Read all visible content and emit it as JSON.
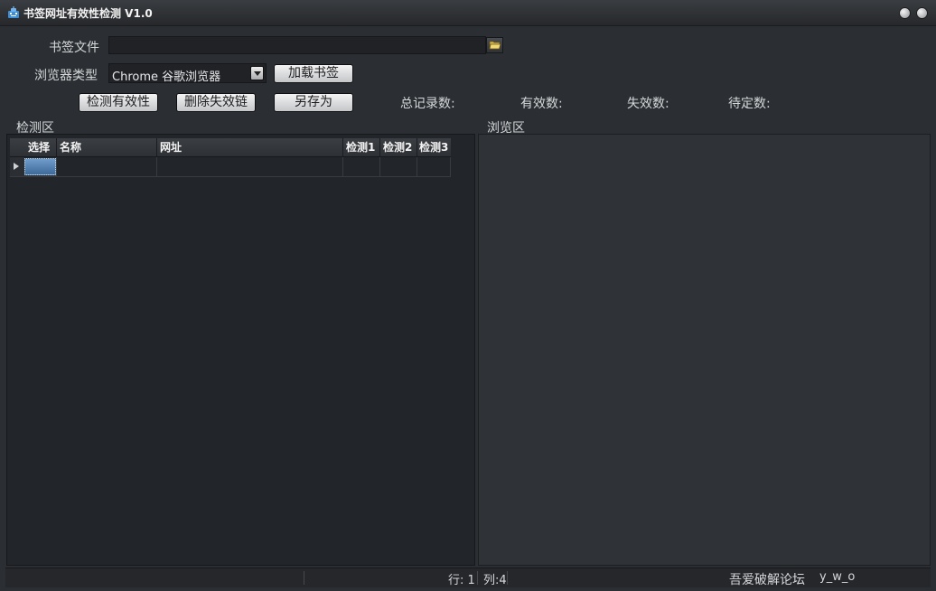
{
  "window": {
    "title": "书签网址有效性检测 V1.0"
  },
  "form": {
    "bookmark_file_label": "书签文件",
    "bookmark_file_value": "",
    "browser_type_label": "浏览器类型",
    "browser_selected": "Chrome 谷歌浏览器",
    "load_button": "加载书签",
    "check_button": "检测有效性",
    "delete_button": "删除失效链",
    "save_as_button": "另存为"
  },
  "stats": {
    "total_label": "总记录数:",
    "valid_label": "有效数:",
    "invalid_label": "失效数:",
    "pending_label": "待定数:"
  },
  "panels": {
    "check_area_label": "检测区",
    "browse_area_label": "浏览区"
  },
  "grid": {
    "columns": [
      "选择",
      "名称",
      "网址",
      "检测1",
      "检测2",
      "检测3"
    ]
  },
  "statusbar": {
    "row_text": "行: 1",
    "col_text": "列:4",
    "forum_text": "吾爱破解论坛",
    "author_text": "y_w_o"
  },
  "icons": {
    "app": "robot-icon",
    "folder": "folder-open-icon",
    "dropdown": "chevron-down-icon"
  }
}
